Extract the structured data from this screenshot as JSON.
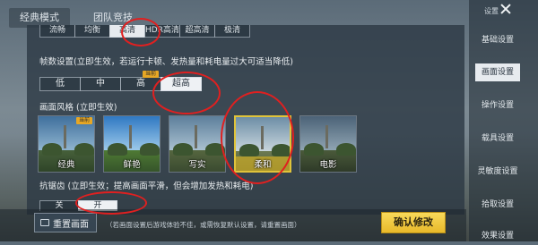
{
  "top_tabs": [
    "经典模式",
    "团队竞技"
  ],
  "quality_options": [
    "流畅",
    "均衡",
    "高清",
    "HDR高清",
    "超高清",
    "极清"
  ],
  "fps": {
    "label": "帧数设置(立即生效，若运行卡顿、发热量和耗电量过大可适当降低)",
    "options": [
      "低",
      "中",
      "高",
      "超高"
    ],
    "badge": "当前"
  },
  "style": {
    "label": "画面风格 (立即生效)",
    "options": [
      "经典",
      "鲜艳",
      "写实",
      "柔和",
      "电影"
    ],
    "badge": "当前"
  },
  "antialias": {
    "label": "抗锯齿 (立即生效；提高画面平滑，但会增加发热和耗电)",
    "options": [
      "关",
      "开"
    ]
  },
  "bottom": {
    "reset_label": "重置画面",
    "hint": "（若画面设置后游戏体验不佳，或需恢复默认设置，请重置画面）",
    "confirm_label": "确认修改"
  },
  "sidebar": {
    "title": "设置",
    "items": [
      "基础设置",
      "画面设置",
      "操作设置",
      "载具设置",
      "灵敏度设置",
      "拾取设置",
      "效果设置"
    ]
  },
  "colors": {
    "accent_yellow": "#e8b92a",
    "annotation_red": "#e02020"
  }
}
